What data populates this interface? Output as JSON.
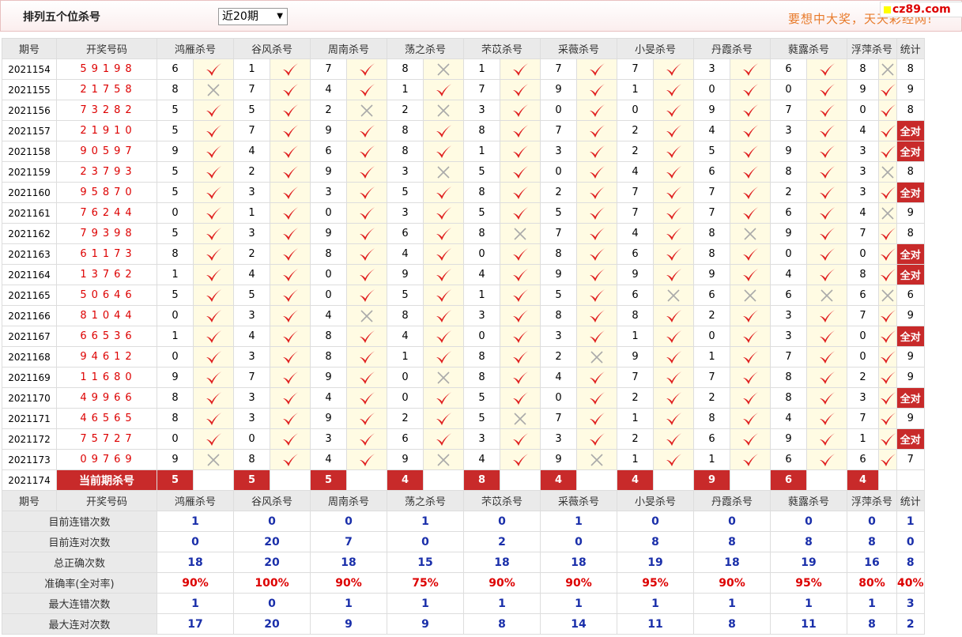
{
  "header": {
    "title": "排列五个位杀号",
    "period_select": "近20期",
    "slogan": "要想中大奖，天天彩经网!",
    "logo": "cz89.com"
  },
  "table": {
    "columns": [
      "期号",
      "开奖号码",
      "鸿雁杀号",
      "谷风杀号",
      "周南杀号",
      "荡之杀号",
      "芣苡杀号",
      "采薇杀号",
      "小旻杀号",
      "丹霞杀号",
      "蕤露杀号",
      "浮萍杀号",
      "统计"
    ],
    "rows": [
      {
        "issue": "2021154",
        "number": "59198",
        "kills": [
          6,
          1,
          7,
          8,
          1,
          7,
          7,
          3,
          6,
          8
        ],
        "marks": [
          1,
          1,
          1,
          0,
          1,
          1,
          1,
          1,
          1,
          0
        ],
        "stat": "8"
      },
      {
        "issue": "2021155",
        "number": "21758",
        "kills": [
          8,
          7,
          4,
          1,
          7,
          9,
          1,
          0,
          0,
          9
        ],
        "marks": [
          0,
          1,
          1,
          1,
          1,
          1,
          1,
          1,
          1,
          1
        ],
        "stat": "9"
      },
      {
        "issue": "2021156",
        "number": "73282",
        "kills": [
          5,
          5,
          2,
          2,
          3,
          0,
          0,
          9,
          7,
          0
        ],
        "marks": [
          1,
          1,
          0,
          0,
          1,
          1,
          1,
          1,
          1,
          1
        ],
        "stat": "8"
      },
      {
        "issue": "2021157",
        "number": "21910",
        "kills": [
          5,
          7,
          9,
          8,
          8,
          7,
          2,
          4,
          3,
          4
        ],
        "marks": [
          1,
          1,
          1,
          1,
          1,
          1,
          1,
          1,
          1,
          1
        ],
        "stat": "全对"
      },
      {
        "issue": "2021158",
        "number": "90597",
        "kills": [
          9,
          4,
          6,
          8,
          1,
          3,
          2,
          5,
          9,
          3
        ],
        "marks": [
          1,
          1,
          1,
          1,
          1,
          1,
          1,
          1,
          1,
          1
        ],
        "stat": "全对"
      },
      {
        "issue": "2021159",
        "number": "23793",
        "kills": [
          5,
          2,
          9,
          3,
          5,
          0,
          4,
          6,
          8,
          3
        ],
        "marks": [
          1,
          1,
          1,
          0,
          1,
          1,
          1,
          1,
          1,
          0
        ],
        "stat": "8"
      },
      {
        "issue": "2021160",
        "number": "95870",
        "kills": [
          5,
          3,
          3,
          5,
          8,
          2,
          7,
          7,
          2,
          3
        ],
        "marks": [
          1,
          1,
          1,
          1,
          1,
          1,
          1,
          1,
          1,
          1
        ],
        "stat": "全对"
      },
      {
        "issue": "2021161",
        "number": "76244",
        "kills": [
          0,
          1,
          0,
          3,
          5,
          5,
          7,
          7,
          6,
          4
        ],
        "marks": [
          1,
          1,
          1,
          1,
          1,
          1,
          1,
          1,
          1,
          0
        ],
        "stat": "9"
      },
      {
        "issue": "2021162",
        "number": "79398",
        "kills": [
          5,
          3,
          9,
          6,
          8,
          7,
          4,
          8,
          9,
          7
        ],
        "marks": [
          1,
          1,
          1,
          1,
          0,
          1,
          1,
          0,
          1,
          1
        ],
        "stat": "8"
      },
      {
        "issue": "2021163",
        "number": "61173",
        "kills": [
          8,
          2,
          8,
          4,
          0,
          8,
          6,
          8,
          0,
          0
        ],
        "marks": [
          1,
          1,
          1,
          1,
          1,
          1,
          1,
          1,
          1,
          1
        ],
        "stat": "全对"
      },
      {
        "issue": "2021164",
        "number": "13762",
        "kills": [
          1,
          4,
          0,
          9,
          4,
          9,
          9,
          9,
          4,
          8
        ],
        "marks": [
          1,
          1,
          1,
          1,
          1,
          1,
          1,
          1,
          1,
          1
        ],
        "stat": "全对"
      },
      {
        "issue": "2021165",
        "number": "50646",
        "kills": [
          5,
          5,
          0,
          5,
          1,
          5,
          6,
          6,
          6,
          6
        ],
        "marks": [
          1,
          1,
          1,
          1,
          1,
          1,
          0,
          0,
          0,
          0
        ],
        "stat": "6"
      },
      {
        "issue": "2021166",
        "number": "81044",
        "kills": [
          0,
          3,
          4,
          8,
          3,
          8,
          8,
          2,
          3,
          7
        ],
        "marks": [
          1,
          1,
          0,
          1,
          1,
          1,
          1,
          1,
          1,
          1
        ],
        "stat": "9"
      },
      {
        "issue": "2021167",
        "number": "66536",
        "kills": [
          1,
          4,
          8,
          4,
          0,
          3,
          1,
          0,
          3,
          0
        ],
        "marks": [
          1,
          1,
          1,
          1,
          1,
          1,
          1,
          1,
          1,
          1
        ],
        "stat": "全对"
      },
      {
        "issue": "2021168",
        "number": "94612",
        "kills": [
          0,
          3,
          8,
          1,
          8,
          2,
          9,
          1,
          7,
          0
        ],
        "marks": [
          1,
          1,
          1,
          1,
          1,
          0,
          1,
          1,
          1,
          1
        ],
        "stat": "9"
      },
      {
        "issue": "2021169",
        "number": "11680",
        "kills": [
          9,
          7,
          9,
          0,
          8,
          4,
          7,
          7,
          8,
          2
        ],
        "marks": [
          1,
          1,
          1,
          0,
          1,
          1,
          1,
          1,
          1,
          1
        ],
        "stat": "9"
      },
      {
        "issue": "2021170",
        "number": "49966",
        "kills": [
          8,
          3,
          4,
          0,
          5,
          0,
          2,
          2,
          8,
          3
        ],
        "marks": [
          1,
          1,
          1,
          1,
          1,
          1,
          1,
          1,
          1,
          1
        ],
        "stat": "全对"
      },
      {
        "issue": "2021171",
        "number": "46565",
        "kills": [
          8,
          3,
          9,
          2,
          5,
          7,
          1,
          8,
          4,
          7
        ],
        "marks": [
          1,
          1,
          1,
          1,
          0,
          1,
          1,
          1,
          1,
          1
        ],
        "stat": "9"
      },
      {
        "issue": "2021172",
        "number": "75727",
        "kills": [
          0,
          0,
          3,
          6,
          3,
          3,
          2,
          6,
          9,
          1
        ],
        "marks": [
          1,
          1,
          1,
          1,
          1,
          1,
          1,
          1,
          1,
          1
        ],
        "stat": "全对"
      },
      {
        "issue": "2021173",
        "number": "09769",
        "kills": [
          9,
          8,
          4,
          9,
          4,
          9,
          1,
          1,
          6,
          6
        ],
        "marks": [
          0,
          1,
          1,
          0,
          1,
          0,
          1,
          1,
          1,
          1
        ],
        "stat": "7"
      }
    ],
    "current": {
      "issue": "2021174",
      "label": "当前期杀号",
      "kills": [
        5,
        5,
        5,
        4,
        8,
        4,
        4,
        9,
        6,
        4
      ]
    },
    "summary": [
      {
        "label": "目前连错次数",
        "values": [
          "1",
          "0",
          "0",
          "1",
          "0",
          "1",
          "0",
          "0",
          "0",
          "0"
        ],
        "stat": "1",
        "style": "sv"
      },
      {
        "label": "目前连对次数",
        "values": [
          "0",
          "20",
          "7",
          "0",
          "2",
          "0",
          "8",
          "8",
          "8",
          "8"
        ],
        "stat": "0",
        "style": "sv"
      },
      {
        "label": "总正确次数",
        "values": [
          "18",
          "20",
          "18",
          "15",
          "18",
          "18",
          "19",
          "18",
          "19",
          "16"
        ],
        "stat": "8",
        "style": "sv"
      },
      {
        "label": "准确率(全对率)",
        "values": [
          "90%",
          "100%",
          "90%",
          "75%",
          "90%",
          "90%",
          "95%",
          "90%",
          "95%",
          "80%"
        ],
        "stat": "40%",
        "style": "sr"
      },
      {
        "label": "最大连错次数",
        "values": [
          "1",
          "0",
          "1",
          "1",
          "1",
          "1",
          "1",
          "1",
          "1",
          "1"
        ],
        "stat": "3",
        "style": "sv"
      },
      {
        "label": "最大连对次数",
        "values": [
          "17",
          "20",
          "9",
          "9",
          "8",
          "14",
          "11",
          "8",
          "11",
          "8"
        ],
        "stat": "2",
        "style": "sv"
      }
    ]
  },
  "colors": {
    "check": "#e02020",
    "cross": "#aaaaaa",
    "highlight": "#c82a2a",
    "accent_text": "#1a2faa"
  }
}
